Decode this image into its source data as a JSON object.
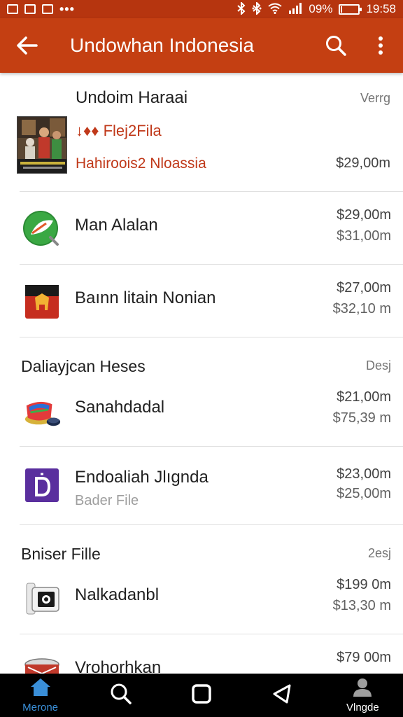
{
  "status_bar": {
    "battery": "09%",
    "battery_level": 0.09,
    "time": "19:58",
    "icons": [
      "notification-icon",
      "gallery-icon",
      "photo-icon",
      "more-dots-icon",
      "bluetooth-icon",
      "sync-icon",
      "wifi-icon",
      "signal-icon",
      "battery-icon"
    ]
  },
  "app_bar": {
    "title": "Undowhan Indonesia",
    "back_icon": "arrow-left-icon",
    "search_icon": "search-icon",
    "menu_icon": "more-vert-icon",
    "color": "#c43f12"
  },
  "featured": {
    "title": "Undoim Haraai",
    "tag": "Verrg",
    "subtitle": "↓♦♦ Flej2Fila",
    "line2": "Hahiroois2 Nloassia",
    "price": "$29,00m"
  },
  "list1": [
    {
      "name": "Man Alalan",
      "price1": "$29,00m",
      "price2": "$31,00m",
      "icon": "green-leaf-icon"
    },
    {
      "name": "Baınn litain Nonian",
      "price1": "$27,00m",
      "price2": "$32,10 m",
      "icon": "flag-badge-icon"
    }
  ],
  "section2": {
    "title": "Daliayjcan Heses",
    "tag": "Desj"
  },
  "list2": [
    {
      "name": "Sanahdadal",
      "price1": "$21,00m",
      "price2": "$75,39 m",
      "icon": "hat-icon",
      "sub": ""
    },
    {
      "name": "Endoaliah Jlıgnda",
      "sub": "Bader File",
      "price1": "$23,00m",
      "price2": "$25,00m",
      "icon": "purple-d-icon"
    }
  ],
  "section3": {
    "title": "Bniser Fille",
    "tag": "2esj"
  },
  "list3": [
    {
      "name": "Nalkadanbl",
      "price1": "$199 0m",
      "price2": "$13,30 m",
      "icon": "camera-icon"
    },
    {
      "name": "Vrohorhkan",
      "price1": "$79 00m",
      "price2": "",
      "icon": "drum-icon"
    }
  ],
  "bottom_nav": [
    {
      "label": "Merone",
      "icon": "home-icon",
      "active": true
    },
    {
      "label": "",
      "icon": "search-icon",
      "active": false
    },
    {
      "label": "",
      "icon": "square-icon",
      "active": false
    },
    {
      "label": "",
      "icon": "back-triangle-icon",
      "active": false
    },
    {
      "label": "Vlngde",
      "icon": "person-icon",
      "active": false
    }
  ],
  "colors": {
    "status_bar": "#b6350f",
    "accent": "#c43f12",
    "accent_text": "#c0391a",
    "nav_active": "#3a8fd8"
  }
}
